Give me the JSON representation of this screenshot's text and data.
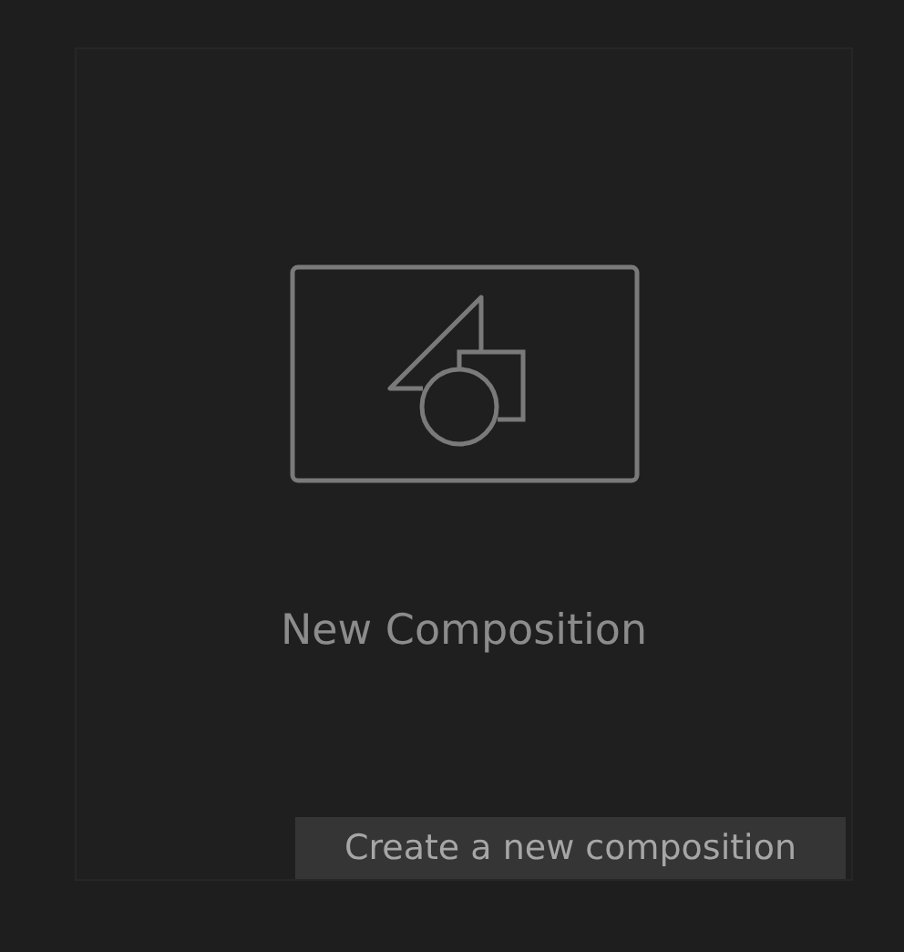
{
  "card": {
    "title": "New Composition"
  },
  "tooltip": {
    "text": "Create a new composition"
  }
}
